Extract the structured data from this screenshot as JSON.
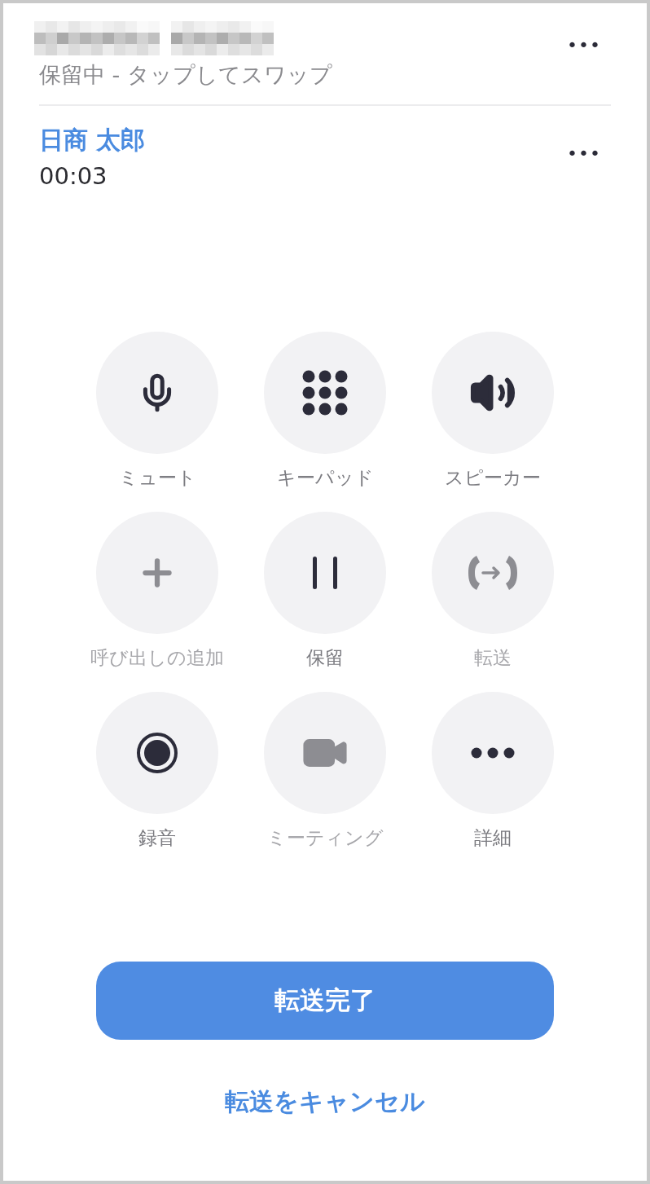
{
  "held_call": {
    "status": "保留中 - タップしてスワップ",
    "menu": "•••"
  },
  "active_call": {
    "name": "日商 太郎",
    "duration": "00:03",
    "menu": "•••"
  },
  "controls": [
    {
      "kind": "mute",
      "label": "ミュート",
      "disabled": false
    },
    {
      "kind": "keypad",
      "label": "キーパッド",
      "disabled": false
    },
    {
      "kind": "speaker",
      "label": "スピーカー",
      "disabled": false
    },
    {
      "kind": "add",
      "label": "呼び出しの追加",
      "disabled": true
    },
    {
      "kind": "hold",
      "label": "保留",
      "disabled": false
    },
    {
      "kind": "transfer",
      "label": "転送",
      "disabled": true
    },
    {
      "kind": "record",
      "label": "録音",
      "disabled": false
    },
    {
      "kind": "meeting",
      "label": "ミーティング",
      "disabled": true
    },
    {
      "kind": "more",
      "label": "詳細",
      "disabled": false
    }
  ],
  "primary_button": "転送完了",
  "cancel_link": "転送をキャンセル"
}
